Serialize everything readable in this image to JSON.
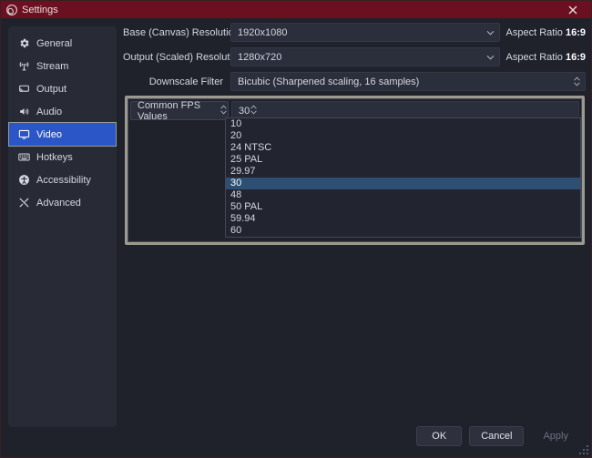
{
  "window": {
    "title": "Settings",
    "logo_icon": "obs-logo-icon",
    "close_icon": "close-icon",
    "titlebar_color": "#6b1020",
    "background_color": "#1f212b"
  },
  "sidebar": {
    "items": [
      {
        "label": "General",
        "icon": "gear-icon",
        "selected": false
      },
      {
        "label": "Stream",
        "icon": "broadcast-icon",
        "selected": false
      },
      {
        "label": "Output",
        "icon": "screencast-icon",
        "selected": false
      },
      {
        "label": "Audio",
        "icon": "speaker-icon",
        "selected": false
      },
      {
        "label": "Video",
        "icon": "monitor-icon",
        "selected": true
      },
      {
        "label": "Hotkeys",
        "icon": "keyboard-icon",
        "selected": false
      },
      {
        "label": "Accessibility",
        "icon": "accessibility-icon",
        "selected": false
      },
      {
        "label": "Advanced",
        "icon": "tools-icon",
        "selected": false
      }
    ],
    "selected_color": "#2a56c8"
  },
  "video": {
    "base_resolution": {
      "label": "Base (Canvas) Resolution",
      "value": "1920x1080",
      "aspect_prefix": "Aspect Ratio ",
      "aspect_value": "16:9",
      "arrow_icon": "chevron-down-icon"
    },
    "output_resolution": {
      "label": "Output (Scaled) Resolution",
      "value": "1280x720",
      "aspect_prefix": "Aspect Ratio ",
      "aspect_value": "16:9",
      "arrow_icon": "chevron-down-icon"
    },
    "downscale_filter": {
      "label": "Downscale Filter",
      "value": "Bicubic (Sharpened scaling, 16 samples)",
      "arrow_icon": "spinner-updown-icon"
    },
    "fps": {
      "mode_label": "Common FPS Values",
      "mode_arrow_icon": "spinner-updown-icon",
      "value": "30",
      "value_arrow_icon": "spinner-updown-icon",
      "focus_border_color": "#9c9a90",
      "options": [
        {
          "label": "10",
          "selected": false
        },
        {
          "label": "20",
          "selected": false
        },
        {
          "label": "24 NTSC",
          "selected": false
        },
        {
          "label": "25 PAL",
          "selected": false
        },
        {
          "label": "29.97",
          "selected": false
        },
        {
          "label": "30",
          "selected": true
        },
        {
          "label": "48",
          "selected": false
        },
        {
          "label": "50 PAL",
          "selected": false
        },
        {
          "label": "59.94",
          "selected": false
        },
        {
          "label": "60",
          "selected": false
        }
      ],
      "option_selected_color": "#2c4f73"
    }
  },
  "footer": {
    "ok_label": "OK",
    "cancel_label": "Cancel",
    "apply_label": "Apply",
    "apply_enabled": false
  }
}
